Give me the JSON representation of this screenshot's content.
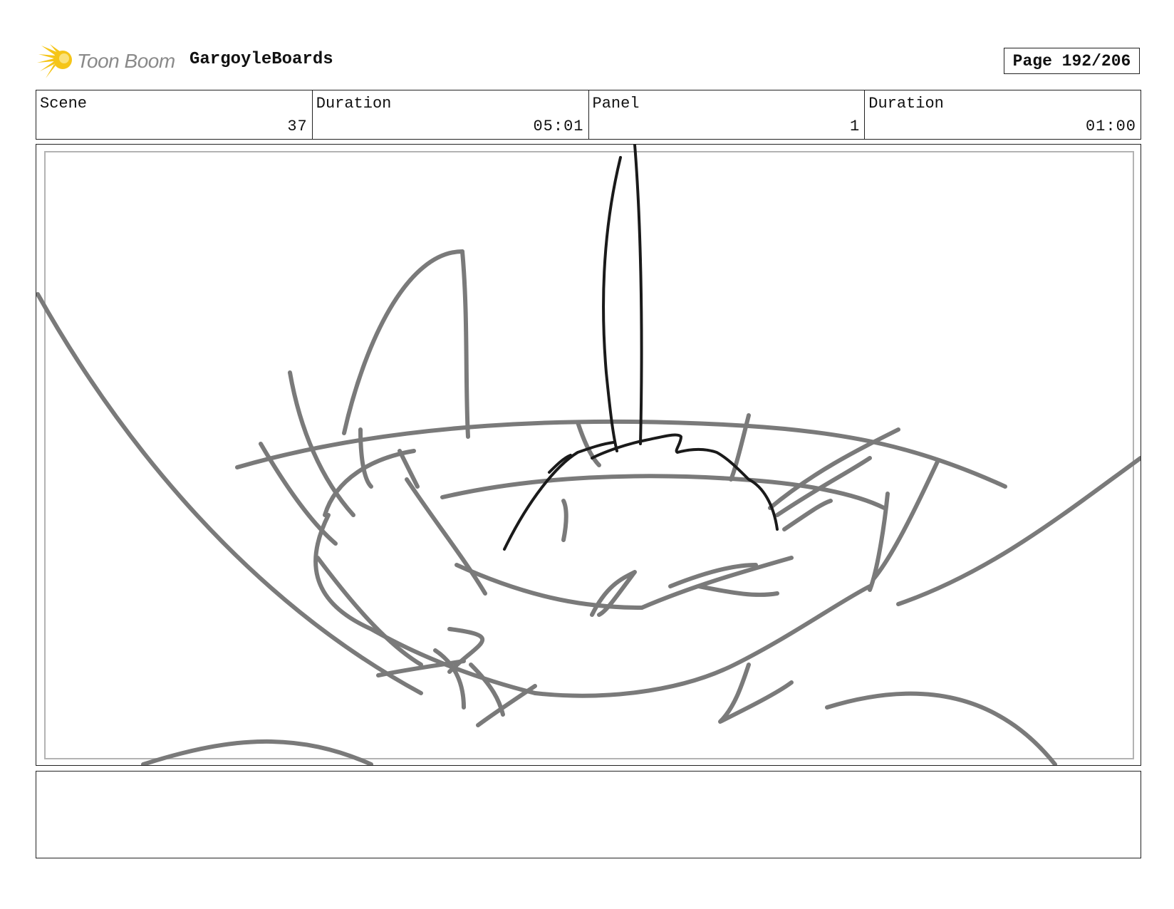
{
  "header": {
    "brand_name": "Toon Boom",
    "project_title": "GargoyleBoards",
    "page_label": "Page 192/206",
    "logo_icon": "starburst-icon",
    "logo_color": "#f5c518"
  },
  "info": {
    "scene_label": "Scene",
    "scene_value": "37",
    "scene_duration_label": "Duration",
    "scene_duration_value": "05:01",
    "panel_label": "Panel",
    "panel_value": "1",
    "panel_duration_label": "Duration",
    "panel_duration_value": "01:00"
  },
  "panel": {
    "sketch_colors": {
      "rough": "#7a7a7a",
      "ink": "#1a1a1a"
    }
  },
  "caption": {
    "text": ""
  }
}
